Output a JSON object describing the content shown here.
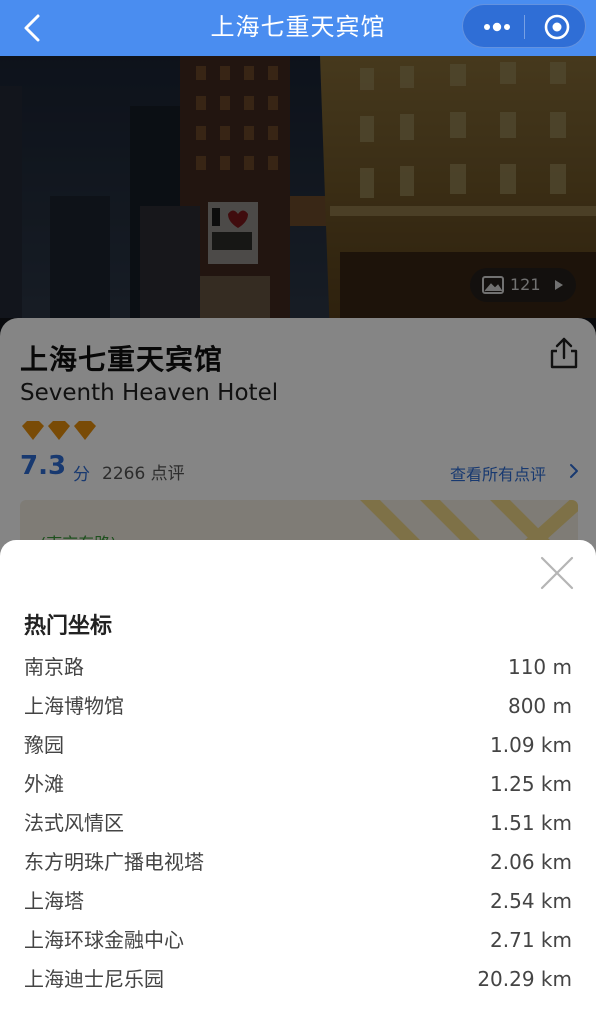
{
  "navbar": {
    "title": "上海七重天宾馆",
    "back_icon": "chevron-left-icon",
    "more_icon": "more-dots-icon",
    "close_icon": "target-circle-icon",
    "color": "#4a8df0"
  },
  "hero": {
    "photo_count": "121",
    "gallery_icon": "image-icon",
    "arrow_icon": "play-arrow-icon"
  },
  "hotel": {
    "name_cn": "上海七重天宾馆",
    "name_en": "Seventh Heaven Hotel",
    "diamond_rating": 3,
    "score": "7.3",
    "score_unit": "分",
    "review_count": "2266 点评",
    "all_reviews_link": "查看所有点评",
    "share_icon": "share-icon",
    "map_label": "(南京东路)",
    "accent_color": "#2f6ed6",
    "diamond_color": "#e8900c"
  },
  "sheet": {
    "title": "热门坐标",
    "close_icon": "close-x-icon",
    "landmarks": [
      {
        "name": "南京路",
        "distance": "110 m"
      },
      {
        "name": "上海博物馆",
        "distance": "800 m"
      },
      {
        "name": "豫园",
        "distance": "1.09 km"
      },
      {
        "name": "外滩",
        "distance": "1.25 km"
      },
      {
        "name": "法式风情区",
        "distance": "1.51 km"
      },
      {
        "name": "东方明珠广播电视塔",
        "distance": "2.06 km"
      },
      {
        "name": "上海塔",
        "distance": "2.54 km"
      },
      {
        "name": "上海环球金融中心",
        "distance": "2.71 km"
      },
      {
        "name": "上海迪士尼乐园",
        "distance": "20.29 km"
      }
    ]
  }
}
